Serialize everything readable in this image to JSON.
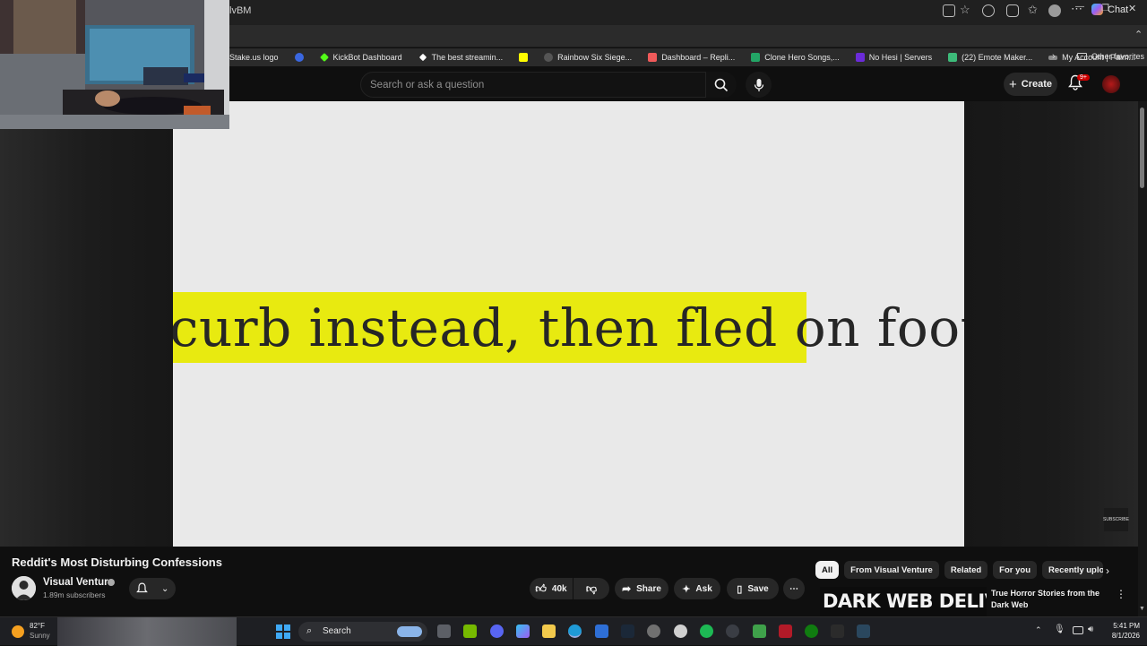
{
  "browser": {
    "url_fragment": "lvBM",
    "chat_label": "Chat",
    "bookmarks": [
      {
        "label": "Stake.us logo",
        "color": "#2b2b2b"
      },
      {
        "label": "KickBot Dashboard",
        "color": "#53fc18"
      },
      {
        "label": "The best streamin...",
        "color": "#ffffff"
      },
      {
        "label": "",
        "color": "#fffc00"
      },
      {
        "label": "Rainbow Six Siege...",
        "color": "#dddddd"
      },
      {
        "label": "Dashboard – Repli...",
        "color": "#f05a5a"
      },
      {
        "label": "Clone Hero Songs,...",
        "color": "#23a566"
      },
      {
        "label": "No Hesi | Servers",
        "color": "#6b2bd9"
      },
      {
        "label": "(22) Emote Maker...",
        "color": "#3dbb7a"
      },
      {
        "label": "My Account | Palm...",
        "color": "#2b2b2b"
      }
    ],
    "other_favorites": "Other favorites"
  },
  "youtube": {
    "search_placeholder": "Search or ask a question",
    "create_label": "Create",
    "notification_count": "9+"
  },
  "video": {
    "caption_text": "curb instead, then fled on foot,",
    "title": "Reddit's Most Disturbing Confessions",
    "channel_name": "Visual Venture",
    "subscribers": "1.89m subscribers",
    "likes": "40k",
    "share_label": "Share",
    "ask_label": "Ask",
    "save_label": "Save",
    "watermark": "SUBSCRIBE",
    "highlight_color": "#e8ea10"
  },
  "chips": [
    "All",
    "From Visual Venture",
    "Related",
    "For you",
    "Recently uplo"
  ],
  "recommendation": {
    "thumb_text": "DARK WEB DELIVERY",
    "title": "True Horror Stories from the Dark Web"
  },
  "taskbar": {
    "weather_temp": "82°F",
    "weather_desc": "Sunny",
    "search_label": "Search",
    "time": "5:41 PM",
    "date": "8/1/2026"
  }
}
